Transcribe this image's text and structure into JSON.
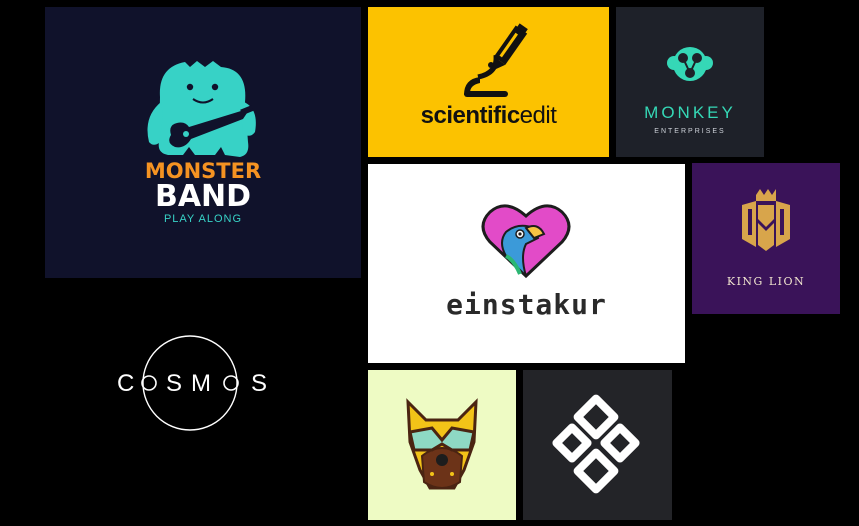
{
  "tiles": {
    "monster": {
      "line1": "MONSTER",
      "line2": "BAND",
      "line3": "PLAY ALONG"
    },
    "scientific": {
      "bold": "scientific",
      "rest": "edit"
    },
    "monkey": {
      "name": "MONKEY",
      "sub": "ENTERPRISES"
    },
    "einstakur": {
      "name": "einstakur"
    },
    "kinglion": {
      "name": "KING LION"
    },
    "cosmos": {
      "letters": [
        "C",
        "S",
        "M",
        "S"
      ]
    },
    "dog": {},
    "knot": {}
  },
  "colors": {
    "monster_bg": "#10122b",
    "monster_teal": "#37d2c6",
    "monster_orange": "#f59322",
    "scientific_bg": "#fcc200",
    "monkey_bg": "#1e2129",
    "monkey_teal": "#35d8b6",
    "kinglion_bg": "#3a1359",
    "kinglion_gold": "#d8a54b",
    "dog_bg": "#eefbc4",
    "knot_bg": "#232428"
  },
  "icons": [
    "monster-guitar-icon",
    "microscope-pencil-icon",
    "monkey-face-icon",
    "parrot-heart-icon",
    "lion-crown-icon",
    "cosmos-ring-icon",
    "dog-mask-icon",
    "knot-icon"
  ]
}
